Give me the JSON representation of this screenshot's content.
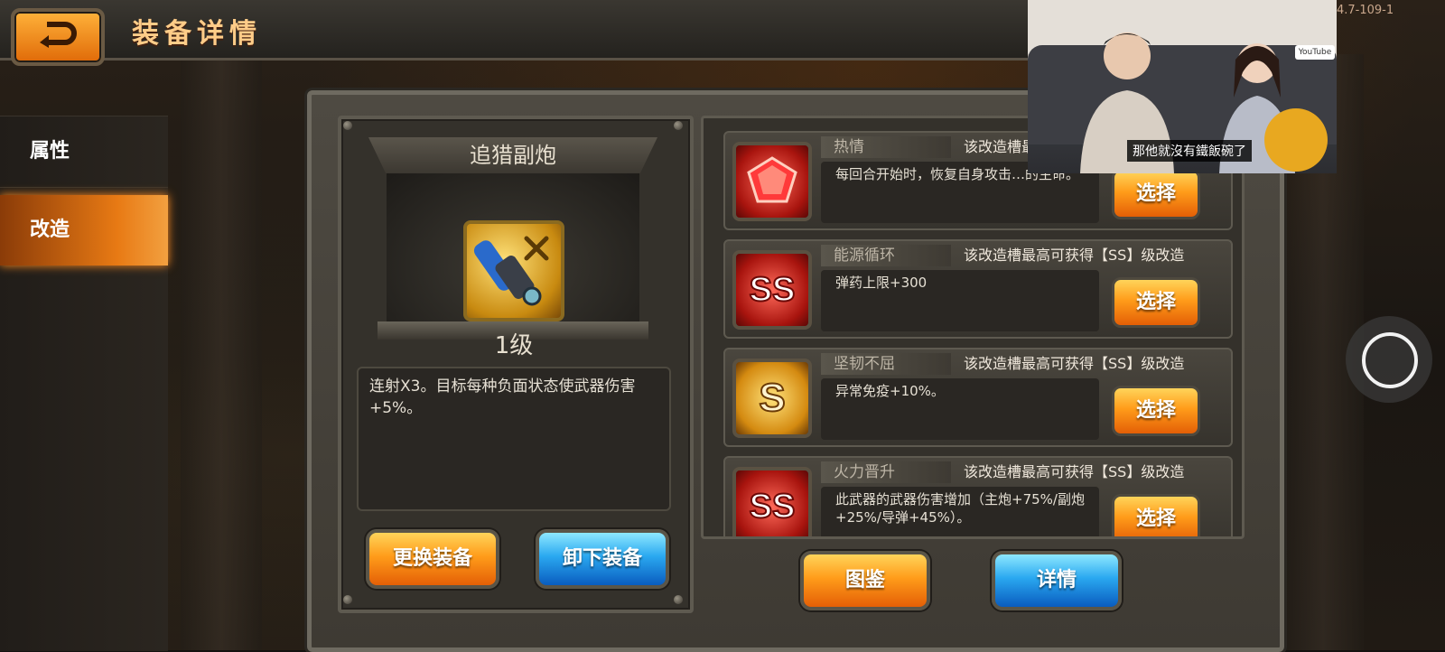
{
  "header": {
    "title": "装备详情",
    "version": "4.7-109-1"
  },
  "sidenav": {
    "items": [
      {
        "label": "属性"
      },
      {
        "label": "改造"
      }
    ]
  },
  "equipment": {
    "name": "追猎副炮",
    "level": "1级",
    "description": "连射X3。目标每种负面状态使武器伤害+5%。",
    "change_label": "更换装备",
    "unequip_label": "卸下装备"
  },
  "mods": [
    {
      "name": "热情",
      "cap": "该改造槽最高可获得【SS】级改造",
      "effect": "每回合开始时，恢复自身攻击…的生命。",
      "icon": "ruby-gem-icon",
      "select_label": "选择"
    },
    {
      "name": "能源循环",
      "cap": "该改造槽最高可获得【SS】级改造",
      "effect": "弹药上限+300",
      "icon": "ss-rank-icon",
      "badge": "SS",
      "select_label": "选择"
    },
    {
      "name": "坚韧不屈",
      "cap": "该改造槽最高可获得【SS】级改造",
      "effect": "异常免疫+10%。",
      "icon": "s-rank-icon",
      "badge": "S",
      "select_label": "选择"
    },
    {
      "name": "火力晋升",
      "cap": "该改造槽最高可获得【SS】级改造",
      "effect": "此武器的武器伤害增加（主炮+75%/副炮+25%/导弹+45%）。",
      "icon": "ss-rank-icon",
      "badge": "SS",
      "select_label": "选择"
    }
  ],
  "footer": {
    "codex_label": "图鉴",
    "detail_label": "详情"
  },
  "webcam": {
    "subtitle": "那他就沒有鐵飯碗了",
    "channel_badge": "YouTube"
  },
  "colors": {
    "accent_orange": "#ff9c1a",
    "accent_blue": "#2aa8f0",
    "panel": "#4e4a42"
  }
}
